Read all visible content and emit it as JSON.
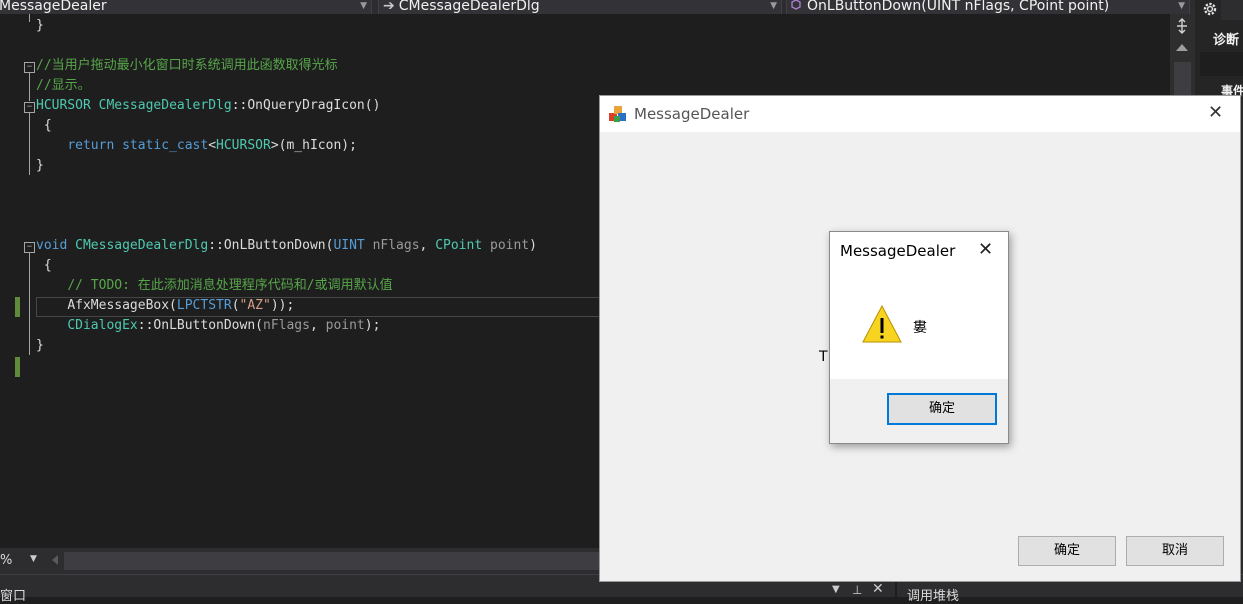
{
  "navbar": {
    "project": "MessageDealer",
    "class_name": "CMessageDealerDlg",
    "class_icon": "➔",
    "member": "OnLButtonDown(UINT nFlags, CPoint point)",
    "member_icon": "method-cube-icon"
  },
  "code": {
    "l1_brace": "}",
    "l3_comment": "//当用户拖动最小化窗口时系统调用此函数取得光标",
    "l4_comment": "//显示。",
    "l5_type": "HCURSOR",
    "l5_class": "CMessageDealerDlg",
    "l5_rest": "::OnQueryDragIcon()",
    "l6_brace": "{",
    "l7_return": "return",
    "l7_cast": "static_cast",
    "l7_lt": "<",
    "l7_type": "HCURSOR",
    "l7_rest": ">(m_hIcon);",
    "l8_brace": "}",
    "l12_void": "void",
    "l12_class": "CMessageDealerDlg",
    "l12_fn": "::OnLButtonDown(",
    "l12_uint": "UINT",
    "l12_nflags": "nFlags",
    "l12_comma": ",",
    "l12_cpoint": "CPoint",
    "l12_point": "point",
    "l12_close": ")",
    "l13_brace": "{",
    "l14_comment": "// TODO: 在此添加消息处理程序代码和/或调用默认值",
    "l15_fn": "AfxMessageBox(",
    "l15_macro": "LPCTSTR",
    "l15_open": "(",
    "l15_str": "\"AZ\"",
    "l15_close": "));",
    "l16_class": "CDialogEx",
    "l16_fn": "::OnLButtonDown(",
    "l16_nflags": "nFlags",
    "l16_comma": ", ",
    "l16_point": "point",
    "l16_close": ");",
    "l17_brace": "}"
  },
  "status": {
    "zoom": "%",
    "bottom_left": "窗口",
    "bottom_right": "调用堆栈"
  },
  "right_panel": {
    "item1": "诊断",
    "item2": "事件"
  },
  "main_window": {
    "title": "MessageDealer",
    "bg_text_left": "T",
    "bg_text_right": "。",
    "ok": "确定",
    "cancel": "取消"
  },
  "message_box": {
    "title": "MessageDealer",
    "message": "婁",
    "ok": "确定",
    "icon": "warning-icon"
  },
  "colors": {
    "editor_bg": "#1e1e1e",
    "comment": "#57a64a",
    "keyword": "#569cd6",
    "type": "#4ec9b0",
    "string": "#d69d85",
    "focus_border": "#0078d7"
  }
}
